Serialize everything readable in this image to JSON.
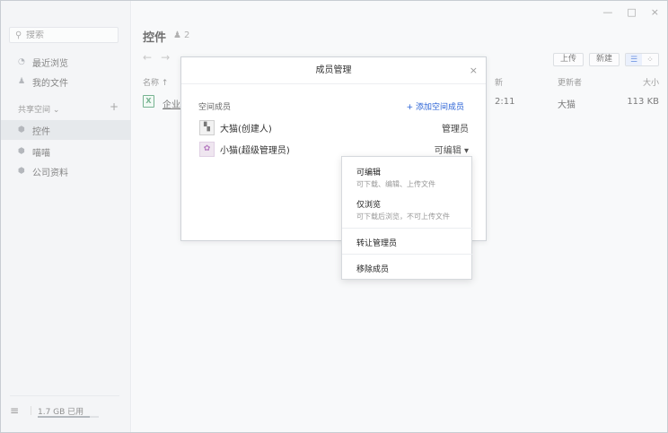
{
  "sidebar": {
    "search_placeholder": "搜索",
    "nav": [
      {
        "label": "最近浏览"
      },
      {
        "label": "我的文件"
      }
    ],
    "section_title": "共享空间 ⌄",
    "section_add": "+",
    "spaces": [
      {
        "label": "控件",
        "active": true
      },
      {
        "label": "喵喵"
      },
      {
        "label": "公司资料"
      }
    ],
    "storage_used": "1.7 GB 已用",
    "storage_fraction": 0.85
  },
  "header": {
    "title": "控件",
    "member_count": "2",
    "upload_label": "上传",
    "new_label": "新建"
  },
  "table": {
    "col_name": "名称 ↑",
    "col_updated": "新",
    "col_updater": "更新者",
    "col_size": "大小",
    "rows": [
      {
        "icon": "X",
        "name": "企业",
        "time": "2:11",
        "updater": "大猫",
        "size": "113 KB"
      }
    ]
  },
  "modal": {
    "title": "成员管理",
    "close": "×",
    "label": "空间成员",
    "add_member": "+ 添加空间成员",
    "members": [
      {
        "name": "大猫(创建人)",
        "role": "管理员"
      },
      {
        "name": "小猫(超级管理员)",
        "role": "可编辑 ▾"
      }
    ]
  },
  "dropdown": {
    "items": [
      {
        "title": "可编辑",
        "desc": "可下载、编辑、上传文件"
      },
      {
        "title": "仅浏览",
        "desc": "可下载后浏览，不可上传文件"
      },
      {
        "title": "转让管理员"
      },
      {
        "title": "移除成员"
      }
    ]
  },
  "window_controls": {
    "minimize": "—",
    "maximize": "□",
    "close": "×"
  }
}
